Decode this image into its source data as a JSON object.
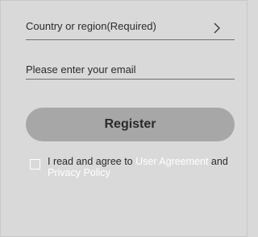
{
  "form": {
    "country_label": "Country or region(Required)",
    "chevron_icon": "chevron-right-icon",
    "email_placeholder": "Please enter your email",
    "email_value": "",
    "register_label": "Register",
    "agree": {
      "checked": false,
      "prefix": "I read and agree to ",
      "user_agreement": "User Agreement",
      "and": " and",
      "privacy_policy": "Privacy Policy"
    }
  },
  "colors": {
    "background": "#d9d9d9",
    "button": "#a7a7a7",
    "link": "#ffffff",
    "text": "#2b2b2b",
    "underline": "#6f6f6f"
  }
}
